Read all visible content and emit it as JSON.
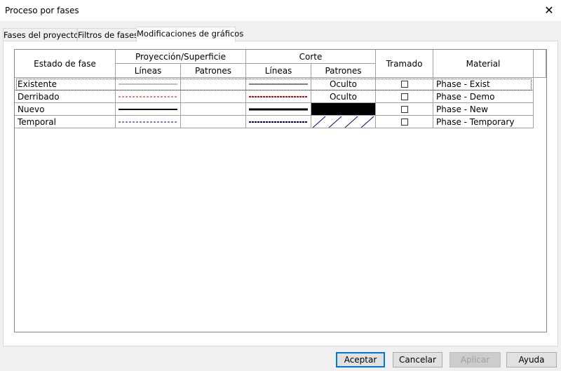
{
  "window": {
    "title": "Proceso por fases",
    "close_icon": "close-icon"
  },
  "tabs": [
    {
      "label": "Fases del proyecto",
      "active": false
    },
    {
      "label": "Filtros de fases",
      "active": false
    },
    {
      "label": "Modificaciones de gráficos",
      "active": true
    }
  ],
  "table": {
    "header": {
      "phase_status": "Estado de fase",
      "projection_surface": "Proyección/Superficie",
      "cut": "Corte",
      "halftone": "Tramado",
      "material": "Material",
      "lines": "Líneas",
      "patterns": "Patrones"
    },
    "rows": [
      {
        "name": "Existente",
        "proj_line": "thin-gray-solid",
        "cut_line": "medium-gray-solid",
        "cut_pattern": "Oculto",
        "halftone": false,
        "material": "Phase - Exist"
      },
      {
        "name": "Derribado",
        "proj_line": "thin-red-dashed",
        "cut_line": "medium-red-dashed",
        "cut_pattern": "Oculto",
        "halftone": false,
        "material": "Phase - Demo"
      },
      {
        "name": "Nuevo",
        "proj_line": "thick-black-solid",
        "cut_line": "thick-black-solid",
        "cut_pattern": "solid-fill",
        "halftone": false,
        "material": "Phase - New"
      },
      {
        "name": "Temporal",
        "proj_line": "thin-navy-dashed",
        "cut_line": "medium-navy-dashed",
        "cut_pattern": "diagonal-hatch",
        "halftone": false,
        "material": "Phase - Temporary"
      }
    ]
  },
  "buttons": {
    "ok": "Aceptar",
    "cancel": "Cancelar",
    "apply": "Aplicar",
    "help": "Ayuda"
  },
  "colors": {
    "demo_line": "#cc0000",
    "temp_line": "#000080",
    "existing_line": "#808080",
    "new_line": "#000000",
    "default_button_border": "#0078d7"
  }
}
